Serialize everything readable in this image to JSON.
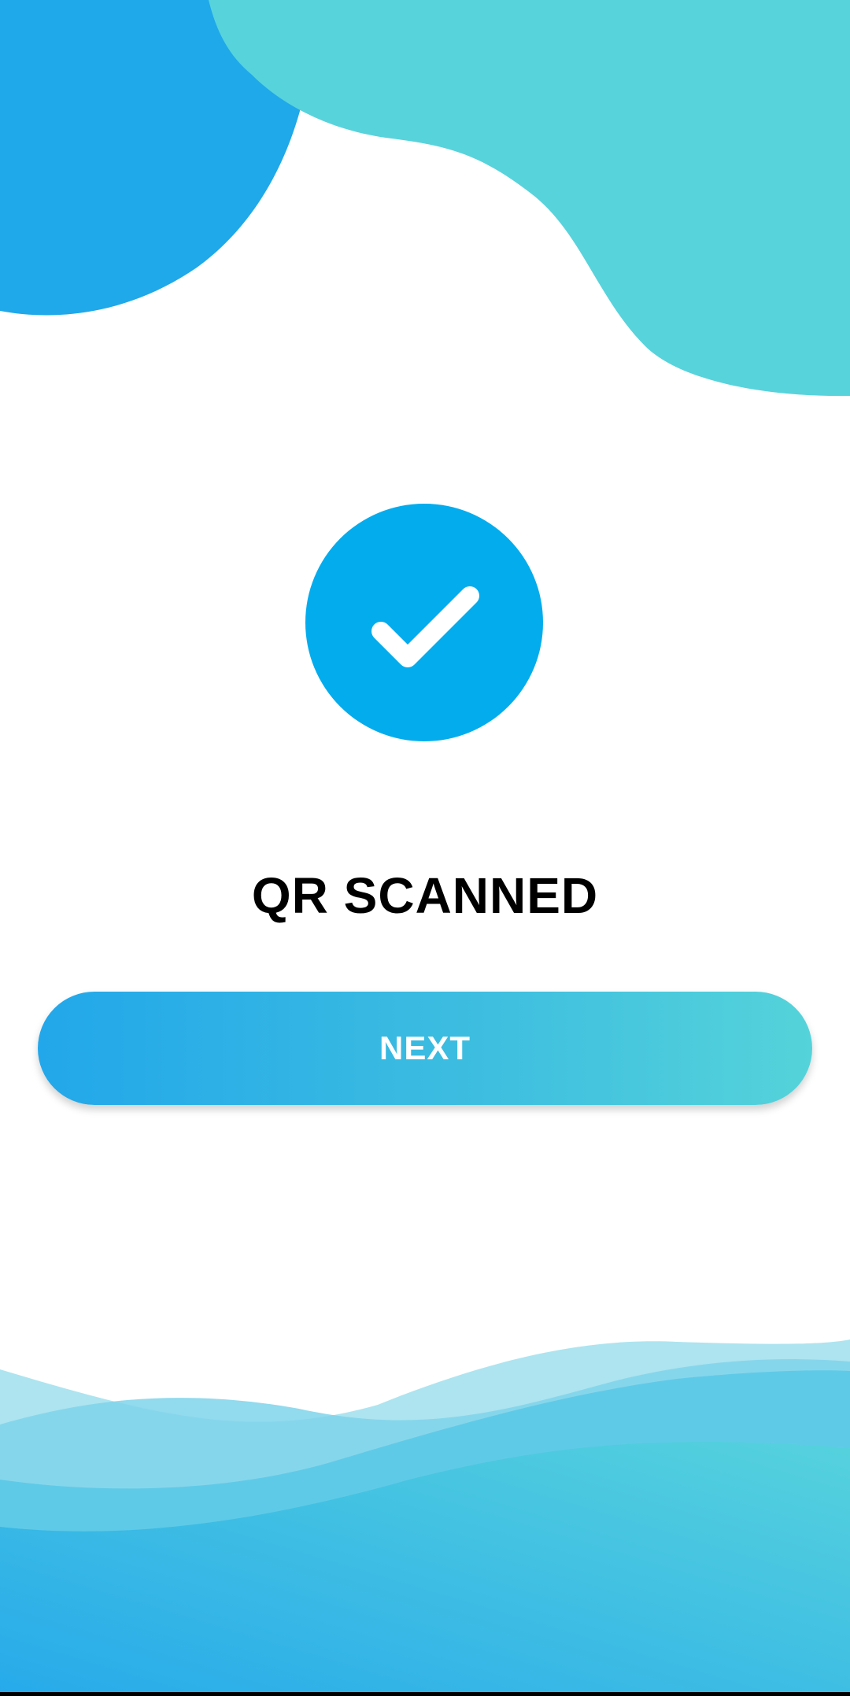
{
  "status": {
    "title": "QR SCANNED",
    "icon": "check-circle-icon"
  },
  "actions": {
    "next_label": "NEXT"
  },
  "colors": {
    "badge_blue": "#03aced",
    "blob_blue": "#1fa8ea",
    "blob_teal": "#57d3dc",
    "button_gradient_start": "#22a7ea",
    "button_gradient_end": "#55d3da",
    "title_text": "#000000",
    "button_text": "#ffffff"
  }
}
